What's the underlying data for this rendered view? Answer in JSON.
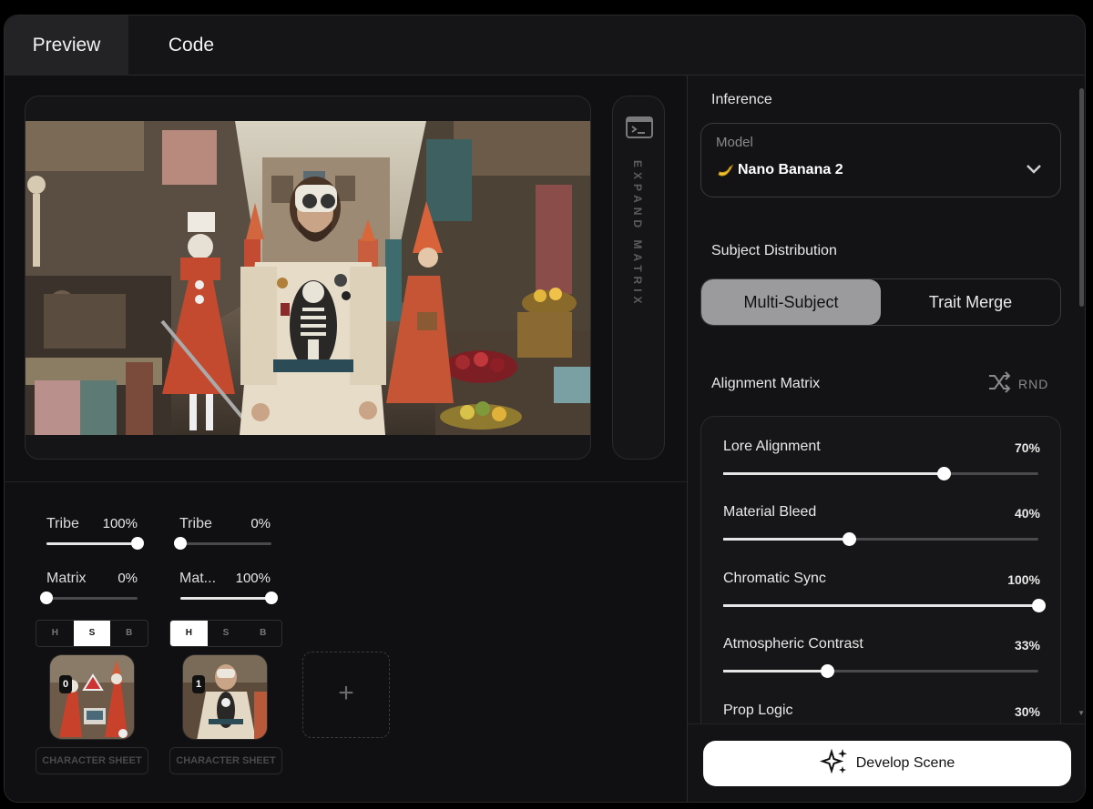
{
  "tabs": {
    "preview": "Preview",
    "code": "Code"
  },
  "preview": {
    "expand_label": "EXPAND MATRIX"
  },
  "subjects": [
    {
      "tribe_label": "Tribe",
      "tribe_value": "100%",
      "tribe_level": 1.0,
      "matrix_label": "Matrix",
      "matrix_value": "0%",
      "matrix_level": 0.0,
      "hsb": [
        "H",
        "S",
        "B"
      ],
      "hsb_selected": "S",
      "index": "0",
      "sheet_label": "CHARACTER SHEET"
    },
    {
      "tribe_label": "Tribe",
      "tribe_value": "0%",
      "tribe_level": 0.0,
      "matrix_label": "Mat...",
      "matrix_value": "100%",
      "matrix_level": 1.0,
      "hsb": [
        "H",
        "S",
        "B"
      ],
      "hsb_selected": "H",
      "index": "1",
      "sheet_label": "CHARACTER SHEET"
    }
  ],
  "add_slot_icon": "+",
  "inference": {
    "title": "Inference",
    "model_label": "Model",
    "model_value": "Nano Banana 2",
    "model_icon": "banana-icon"
  },
  "distribution": {
    "title": "Subject Distribution",
    "options": [
      "Multi-Subject",
      "Trait Merge"
    ],
    "selected": "Multi-Subject"
  },
  "alignment": {
    "title": "Alignment Matrix",
    "rnd_label": "RND",
    "sliders": [
      {
        "label": "Lore Alignment",
        "value": "70%",
        "level": 0.7
      },
      {
        "label": "Material Bleed",
        "value": "40%",
        "level": 0.4
      },
      {
        "label": "Chromatic Sync",
        "value": "100%",
        "level": 1.0
      },
      {
        "label": "Atmospheric Contrast",
        "value": "33%",
        "level": 0.33
      },
      {
        "label": "Prop Logic",
        "value": "30%",
        "level": 0.3
      }
    ]
  },
  "footer": {
    "develop_label": "Develop Scene"
  }
}
